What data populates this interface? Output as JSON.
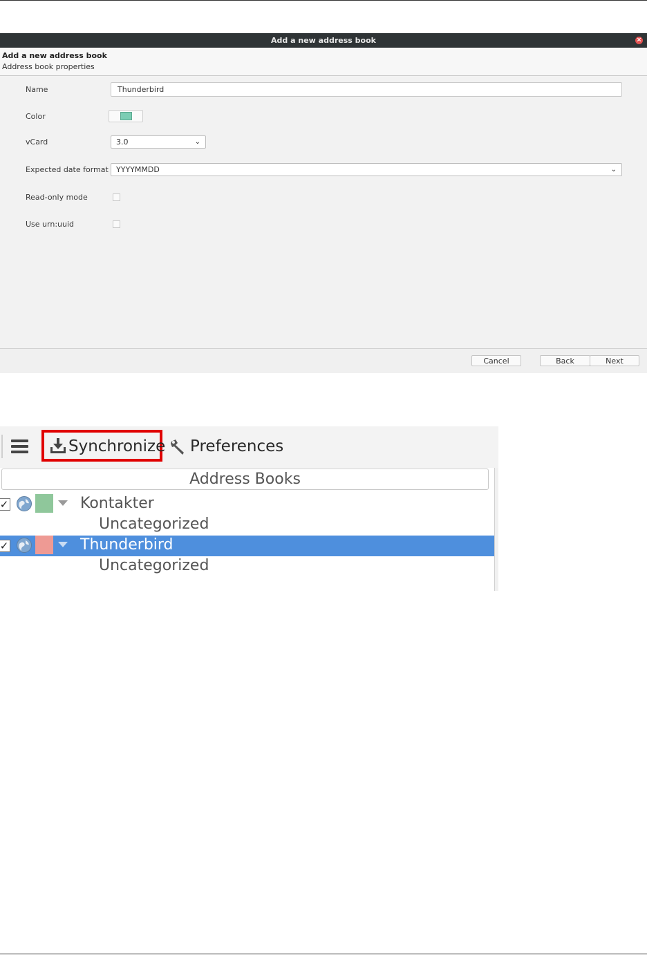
{
  "dialog": {
    "title": "Add a new address book",
    "header_title": "Add a new address book",
    "header_subtitle": "Address book properties",
    "fields": {
      "name_label": "Name",
      "name_value": "Thunderbird",
      "color_label": "Color",
      "color_value": "#7ccdb4",
      "vcard_label": "vCard",
      "vcard_value": "3.0",
      "date_format_label": "Expected date format",
      "date_format_value": "YYYYMMDD",
      "readonly_label": "Read-only mode",
      "urn_label": "Use urn:uuid"
    },
    "buttons": {
      "cancel": "Cancel",
      "back": "Back",
      "next": "Next"
    }
  },
  "toolbar": {
    "synchronize_label": "Synchronize",
    "preferences_label": "Preferences",
    "menu_icon": "hamburger-menu-icon",
    "sync_icon": "download-icon",
    "preferences_icon": "wrench-icon",
    "highlight_color": "#e00000"
  },
  "address_books": {
    "header": "Address Books",
    "items": [
      {
        "name": "Kontakter",
        "color": "#8fc79b",
        "checked": true,
        "selected": false,
        "child": "Uncategorized"
      },
      {
        "name": "Thunderbird",
        "color": "#ee9a94",
        "checked": true,
        "selected": true,
        "child": "Uncategorized"
      }
    ],
    "selection_color": "#4e8fdd"
  }
}
